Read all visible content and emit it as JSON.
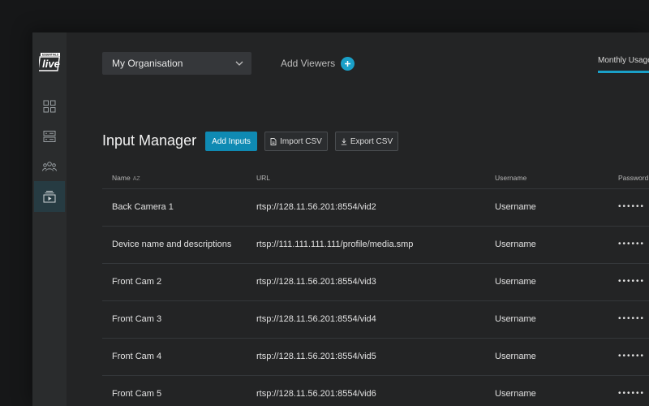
{
  "brand": {
    "logo_text": "live",
    "logo_sub": "ESSENTIALS"
  },
  "sidebar": {
    "items": [
      {
        "name": "dashboard",
        "active": false
      },
      {
        "name": "encoders",
        "active": false
      },
      {
        "name": "users",
        "active": false
      },
      {
        "name": "inputs",
        "active": true
      }
    ]
  },
  "header": {
    "org_select_value": "My Organisation",
    "add_viewers_label": "Add Viewers",
    "tab_label": "Monthly Usage"
  },
  "page": {
    "title": "Input Manager",
    "add_inputs_label": "Add Inputs",
    "import_label": "Import CSV",
    "export_label": "Export CSV"
  },
  "table": {
    "columns": {
      "name": "Name",
      "sort": "AZ",
      "url": "URL",
      "username": "Username",
      "password": "Password"
    },
    "rows": [
      {
        "name": "Back Camera 1",
        "url": "rtsp://128.11.56.201:8554/vid2",
        "username": "Username",
        "password": "••••••"
      },
      {
        "name": "Device name and descriptions",
        "url": "rtsp://111.111.111.111/profile/media.smp",
        "username": "Username",
        "password": "••••••"
      },
      {
        "name": "Front Cam 2",
        "url": "rtsp://128.11.56.201:8554/vid3",
        "username": "Username",
        "password": "••••••"
      },
      {
        "name": "Front Cam 3",
        "url": "rtsp://128.11.56.201:8554/vid4",
        "username": "Username",
        "password": "••••••"
      },
      {
        "name": "Front Cam 4",
        "url": "rtsp://128.11.56.201:8554/vid5",
        "username": "Username",
        "password": "••••••"
      },
      {
        "name": "Front Cam 5",
        "url": "rtsp://128.11.56.201:8554/vid6",
        "username": "Username",
        "password": "••••••"
      }
    ]
  },
  "colors": {
    "accent": "#1aa0c8",
    "primary_button": "#0f8ab3",
    "active_nav": "#263b42"
  }
}
